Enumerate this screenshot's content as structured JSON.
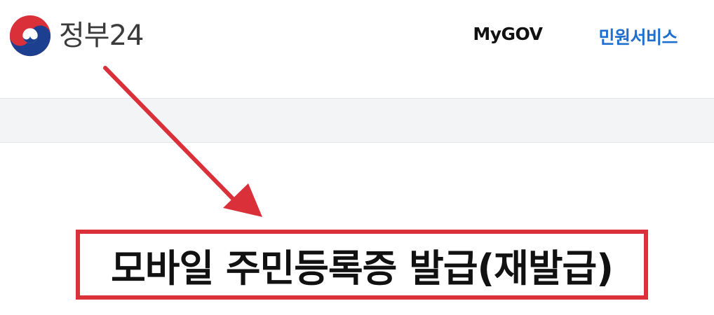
{
  "header": {
    "logo_text": "정부24",
    "nav": [
      {
        "label": "MyGOV"
      },
      {
        "label": "민원서비스"
      }
    ]
  },
  "main": {
    "headline": "모바일 주민등록증 발급(재발급)"
  },
  "colors": {
    "accent_blue": "#1f6fd1",
    "highlight_red": "#d9303a",
    "band_gray": "#f3f4f6"
  },
  "icons": {
    "logo": "korea-government-emblem-icon",
    "annotation": "red-arrow-icon"
  }
}
